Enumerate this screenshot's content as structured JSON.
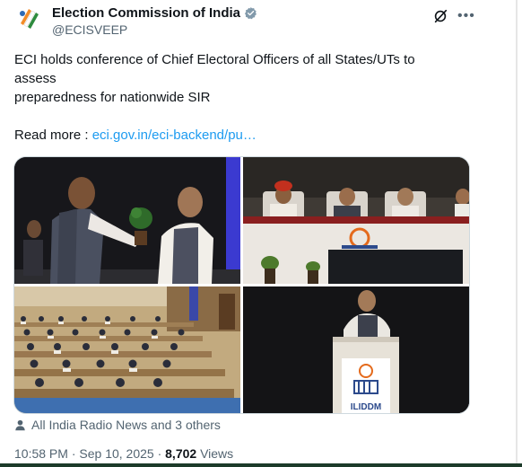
{
  "account": {
    "name": "Election Commission of India",
    "handle": "@ECISVEEP"
  },
  "post": {
    "line1": "ECI holds conference of Chief Electoral Officers of all States/UTs to",
    "line2": "assess",
    "line3": "preparedness for nationwide SIR",
    "read_more_label": "Read more : ",
    "link_text": "eci.gov.in/eci-backend/pu…"
  },
  "images": [
    {
      "name": "photo-felicitation"
    },
    {
      "name": "photo-dais"
    },
    {
      "name": "photo-auditorium"
    },
    {
      "name": "photo-podium-speaker"
    }
  ],
  "podium_sign": "ILIDDM",
  "social": {
    "liked_by": "All India Radio News and 3 others"
  },
  "meta": {
    "time": "10:58 PM",
    "separator": " · ",
    "date": "Sep 10, 2025",
    "separator2": " · ",
    "views_count": "8,702",
    "views_label": " Views"
  },
  "colors": {
    "link": "#1d9bf0",
    "verified": "#829aab",
    "secondary_text": "#536471"
  }
}
